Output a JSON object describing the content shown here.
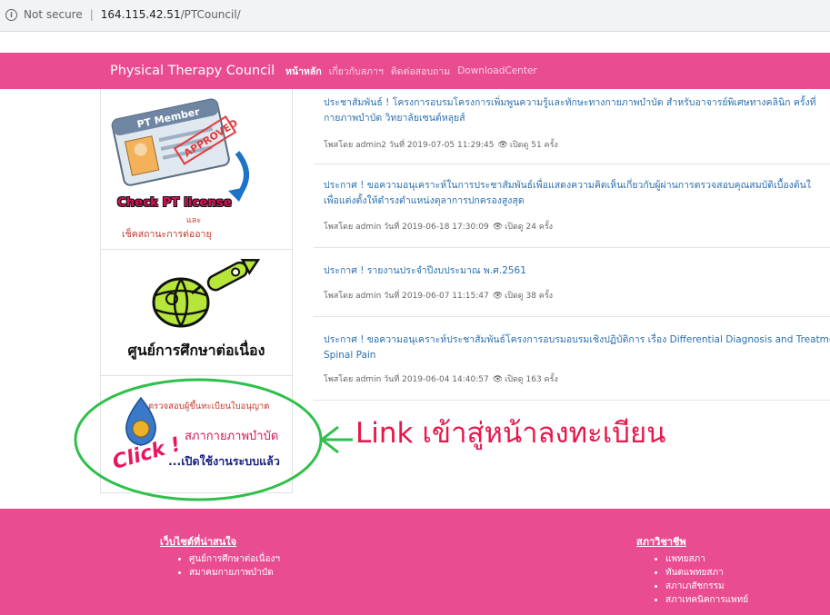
{
  "browser": {
    "security_label": "Not secure",
    "url_host": "164.115.42.51",
    "url_path": "/PTCouncil/"
  },
  "navbar": {
    "brand": "Physical Therapy Council",
    "links": [
      "หน้าหลัก",
      "เกี่ยวกับสภาฯ",
      "ติดต่อสอบถาม",
      "DownloadCenter"
    ]
  },
  "sidebar": {
    "license_banner": {
      "card_text": "PT Member",
      "stamp_text": "APPROVED",
      "title": "Check PT license",
      "and": "และ",
      "subtitle": "เช็คสถานะการต่ออายุ"
    },
    "education_banner": {
      "label": "ศูนย์การศึกษาต่อเนื่อง"
    },
    "register_banner": {
      "line1": "ตรวจสอบผู้ขึ้นทะเบียนใบอนุญาต",
      "line2": "สภากายภาพบำบัด",
      "line3": "...เปิดใช้งานระบบแล้ว",
      "click": "Click !"
    }
  },
  "news": [
    {
      "title_line1": "ประชาสัมพันธ์ ! โครงการอบรมโครงการเพิ่มพูนความรู้และทักษะทางกายภาพบำบัด สำหรับอาจารย์พิเศษทางคลินิก ครั้งที่",
      "title_line2": "กายภาพบำบัด วิทยาลัยเซนต์หลุยส์",
      "meta": "โพสโดย admin2 วันที่ 2019-07-05 11:29:45",
      "views": "เปิดดู 51 ครั้ง"
    },
    {
      "title_line1": "ประกาศ ! ขอความอนุเคราะห์ในการประชาสัมพันธ์เพื่อแสดงความคิดเห็นเกี่ยวกับผู้ผ่านการตรวจสอบคุณสมบัติเบื้องต้นใ",
      "title_line2": "เพื่อแต่งตั้งให้ดำรงตำแหน่งตุลาการปกครองสูงสุด",
      "meta": "โพสโดย admin วันที่ 2019-06-18 17:30:09",
      "views": "เปิดดู 24 ครั้ง"
    },
    {
      "title_line1": "ประกาศ ! รายงานประจำปีงบประมาณ พ.ศ.2561",
      "title_line2": "",
      "meta": "โพสโดย admin วันที่ 2019-06-07 11:15:47",
      "views": "เปิดดู 38 ครั้ง"
    },
    {
      "title_line1": "ประกาศ ! ขอความอนุเคราะห์ประชาสัมพันธ์โครงการอบรมอบรมเชิงปฏิบัติการ เรื่อง Differential Diagnosis and Treatme",
      "title_line2": "Spinal Pain",
      "meta": "โพสโดย admin วันที่ 2019-06-04 14:40:57",
      "views": "เปิดดู 163 ครั้ง"
    }
  ],
  "annotation": {
    "text": "Link เข้าสู่หน้าลงทะเบียน",
    "color": "#e8174a"
  },
  "footer": {
    "left": {
      "heading": "เว็บไซต์ที่น่าสนใจ",
      "items": [
        "ศูนย์การศึกษาต่อเนื่องฯ",
        "สมาคมกายภาพบำบัด"
      ]
    },
    "right": {
      "heading": "สภาวิชาชีพ",
      "items": [
        "แพทยสภา",
        "ทันตแพทยสภา",
        "สภาเภสัชกรรม",
        "สภาเทคนิคการแพทย์"
      ]
    }
  },
  "colors": {
    "brand_pink": "#ea4c92",
    "link_blue": "#2a6fb0",
    "annotation_green": "#2ec04a"
  }
}
